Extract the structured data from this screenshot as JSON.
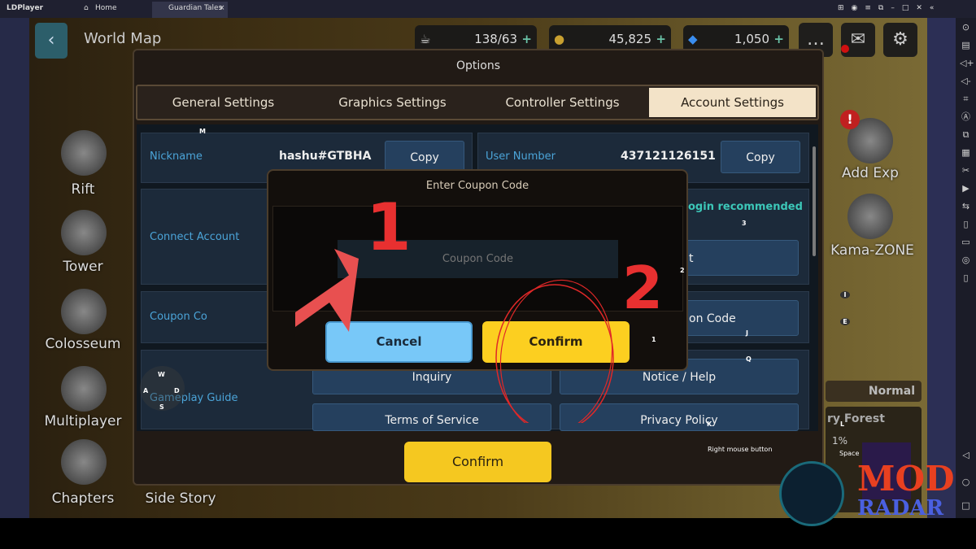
{
  "titlebar": {
    "app": "LDPlayer",
    "tabs": [
      {
        "label": "Home"
      },
      {
        "label": "Guardian Tales"
      }
    ]
  },
  "hud": {
    "title": "World Map",
    "stamina": "138/63",
    "gold": "45,825",
    "gems": "1,050"
  },
  "left_menu": [
    "Rift",
    "Tower",
    "Colosseum",
    "Multiplayer",
    "Chapters",
    "Side Story"
  ],
  "right_menu": [
    "Add Exp",
    "Kama-ZONE"
  ],
  "stage": {
    "difficulty": "Normal",
    "name": "ry Forest",
    "progress": "1%"
  },
  "options": {
    "title": "Options",
    "tabs": [
      "General Settings",
      "Graphics Settings",
      "Controller Settings",
      "Account Settings"
    ],
    "active_tab": "Account Settings",
    "nickname_label": "Nickname",
    "nickname": "hashu#GTBHA",
    "copy": "Copy",
    "user_number_label": "User Number",
    "user_number": "437121126151",
    "connect_label": "Connect Account",
    "login_rec": "ogin recommended",
    "connect_btn": "t",
    "coupon_label": "Coupon Co",
    "coupon_btn": "on Code",
    "guide_label": "Gameplay Guide",
    "inquiry": "Inquiry",
    "notice": "Notice / Help",
    "tos": "Terms of Service",
    "privacy": "Privacy Policy",
    "confirm": "Confirm"
  },
  "dialog": {
    "title": "Enter Coupon Code",
    "placeholder": "Coupon Code",
    "cancel": "Cancel",
    "confirm": "Confirm"
  },
  "annotations": {
    "step1": "1",
    "step2": "2",
    "arrow_color": "#e85050"
  },
  "keys": {
    "m": "M",
    "w": "W",
    "a": "A",
    "s": "S",
    "d": "D",
    "three": "3",
    "two": "2",
    "one": "1",
    "j": "J",
    "q": "Q",
    "k": "K",
    "l": "L",
    "i": "I",
    "e": "E",
    "space": "Space",
    "right_mouse": "Right mouse button"
  },
  "watermark": {
    "line1": "MOD",
    "line2": "RADAR"
  }
}
